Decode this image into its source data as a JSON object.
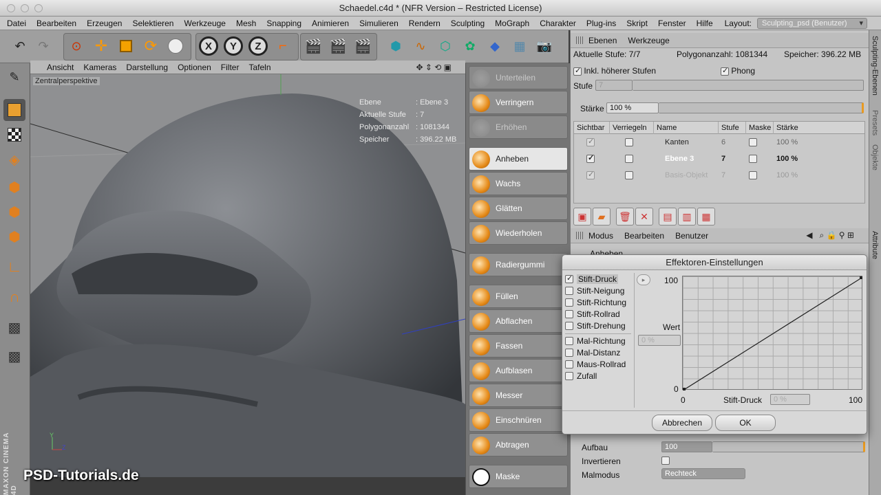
{
  "window": {
    "title": "Schaedel.c4d * (NFR Version – Restricted License)"
  },
  "menu": [
    "Datei",
    "Bearbeiten",
    "Erzeugen",
    "Selektieren",
    "Werkzeuge",
    "Mesh",
    "Snapping",
    "Animieren",
    "Simulieren",
    "Rendern",
    "Sculpting",
    "MoGraph",
    "Charakter",
    "Plug-ins",
    "Skript",
    "Fenster",
    "Hilfe"
  ],
  "layout": {
    "label": "Layout:",
    "value": "Sculpting_psd (Benutzer)"
  },
  "viewport": {
    "menu": [
      "Ansicht",
      "Kameras",
      "Darstellung",
      "Optionen",
      "Filter",
      "Tafeln"
    ],
    "label": "Zentralperspektive",
    "info": [
      {
        "k": "Ebene",
        "v": ": Ebene 3"
      },
      {
        "k": "Aktuelle Stufe",
        "v": ": 7"
      },
      {
        "k": "Polygonanzahl",
        "v": ": 1081344"
      },
      {
        "k": "Speicher",
        "v": ": 396.22 MB"
      }
    ],
    "watermark": "PSD-Tutorials.de",
    "brand": "MAXON CINEMA 4D"
  },
  "brushes": [
    "Unterteilen",
    "Verringern",
    "Erhöhen",
    "Anheben",
    "Wachs",
    "Glätten",
    "Wiederholen",
    "Radiergummi",
    "Füllen",
    "Abflachen",
    "Fassen",
    "Aufblasen",
    "Messer",
    "Einschnüren",
    "Abtragen",
    "Maske"
  ],
  "layers_panel": {
    "tabs": [
      "Ebenen",
      "Werkzeuge"
    ],
    "stats": {
      "stufe": "Aktuelle Stufe: 7/7",
      "poly": "Polygonanzahl: 1081344",
      "mem": "Speicher: 396.22 MB"
    },
    "incl": "Inkl. höherer Stufen",
    "phong": "Phong",
    "stufe_label": "Stufe",
    "stufe_value": "7",
    "staerke_label": "Stärke",
    "staerke_value": "100 %",
    "columns": [
      "Sichtbar",
      "Verriegeln",
      "Name",
      "Stufe",
      "Maske",
      "Stärke"
    ],
    "rows": [
      {
        "name": "Kanten",
        "stufe": "6",
        "staerke": "100 %"
      },
      {
        "name": "Ebene 3",
        "stufe": "7",
        "staerke": "100 %"
      },
      {
        "name": "Basis-Objekt",
        "stufe": "7",
        "staerke": "100 %"
      }
    ]
  },
  "attr_panel": {
    "tabs": [
      "Modus",
      "Bearbeiten",
      "Benutzer"
    ],
    "title": "Anheben",
    "aufbau_label": "Aufbau",
    "aufbau_value": "100",
    "invertieren_label": "Invertieren",
    "malmodus_label": "Malmodus",
    "malmodus_value": "Rechteck"
  },
  "side_tabs": [
    "Sculpting-Ebenen",
    "Presets",
    "Objekte",
    "Attribute"
  ],
  "dialog": {
    "title": "Effektoren-Einstellungen",
    "options": [
      {
        "label": "Stift-Druck",
        "checked": true
      },
      {
        "label": "Stift-Neigung",
        "checked": false
      },
      {
        "label": "Stift-Richtung",
        "checked": false
      },
      {
        "label": "Stift-Rollrad",
        "checked": false
      },
      {
        "label": "Stift-Drehung",
        "checked": false
      },
      {
        "label": "Mal-Richtung",
        "checked": false
      },
      {
        "label": "Mal-Distanz",
        "checked": false
      },
      {
        "label": "Maus-Rollrad",
        "checked": false
      },
      {
        "label": "Zufall",
        "checked": false
      }
    ],
    "wert_label": "Wert",
    "wert_value": "0 %",
    "y_max": "100",
    "y_min": "0",
    "x_min": "0",
    "x_max": "100",
    "x_label": "Stift-Druck",
    "x_value": "0 %",
    "cancel": "Abbrechen",
    "ok": "OK"
  }
}
